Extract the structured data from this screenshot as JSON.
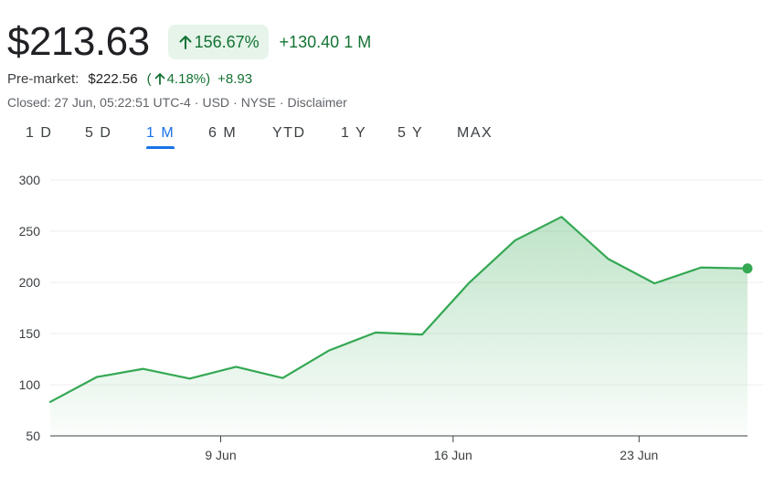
{
  "header": {
    "price": "$213.63",
    "percent_change": "156.67%",
    "absolute_change": "+130.40",
    "period": "1 M",
    "trend": "up"
  },
  "premarket": {
    "label": "Pre-market:",
    "price": "$222.56",
    "percent_open": "(",
    "percent": "4.18%",
    "percent_close": ")",
    "change": "+8.93"
  },
  "status": {
    "closed": "Closed: 27 Jun, 05:22:51 UTC-4",
    "currency": "USD",
    "exchange": "NYSE",
    "disclaimer": "Disclaimer",
    "separator": "·"
  },
  "tabs": [
    {
      "label": "1 D",
      "active": false
    },
    {
      "label": "5 D",
      "active": false
    },
    {
      "label": "1 M",
      "active": true
    },
    {
      "label": "6 M",
      "active": false
    },
    {
      "label": "YTD",
      "active": false
    },
    {
      "label": "1 Y",
      "active": false
    },
    {
      "label": "5 Y",
      "active": false
    },
    {
      "label": "MAX",
      "active": false
    }
  ],
  "colors": {
    "positive": "#137333",
    "positive_bg": "#e6f4ea",
    "line": "#34a853",
    "active_tab": "#1a73e8"
  },
  "chart_data": {
    "type": "area",
    "x": [
      "2024-06-04",
      "2024-06-05",
      "2024-06-06",
      "2024-06-07",
      "2024-06-10",
      "2024-06-11",
      "2024-06-12",
      "2024-06-13",
      "2024-06-14",
      "2024-06-17",
      "2024-06-18",
      "2024-06-20",
      "2024-06-21",
      "2024-06-24",
      "2024-06-25",
      "2024-06-26"
    ],
    "values": [
      83.2,
      107.5,
      115.5,
      106,
      117.5,
      106.5,
      133.5,
      151,
      149,
      199,
      241,
      264,
      223,
      199,
      214.5,
      213.63
    ],
    "x_tick_labels": [
      "9 Jun",
      "16 Jun",
      "23 Jun"
    ],
    "x_tick_dates": [
      "2024-06-09",
      "2024-06-16",
      "2024-06-23"
    ],
    "y_ticks": [
      300,
      250,
      200,
      150,
      100,
      50
    ],
    "ylim": [
      50,
      300
    ],
    "grid": true,
    "title": "",
    "xlabel": "",
    "ylabel": ""
  }
}
